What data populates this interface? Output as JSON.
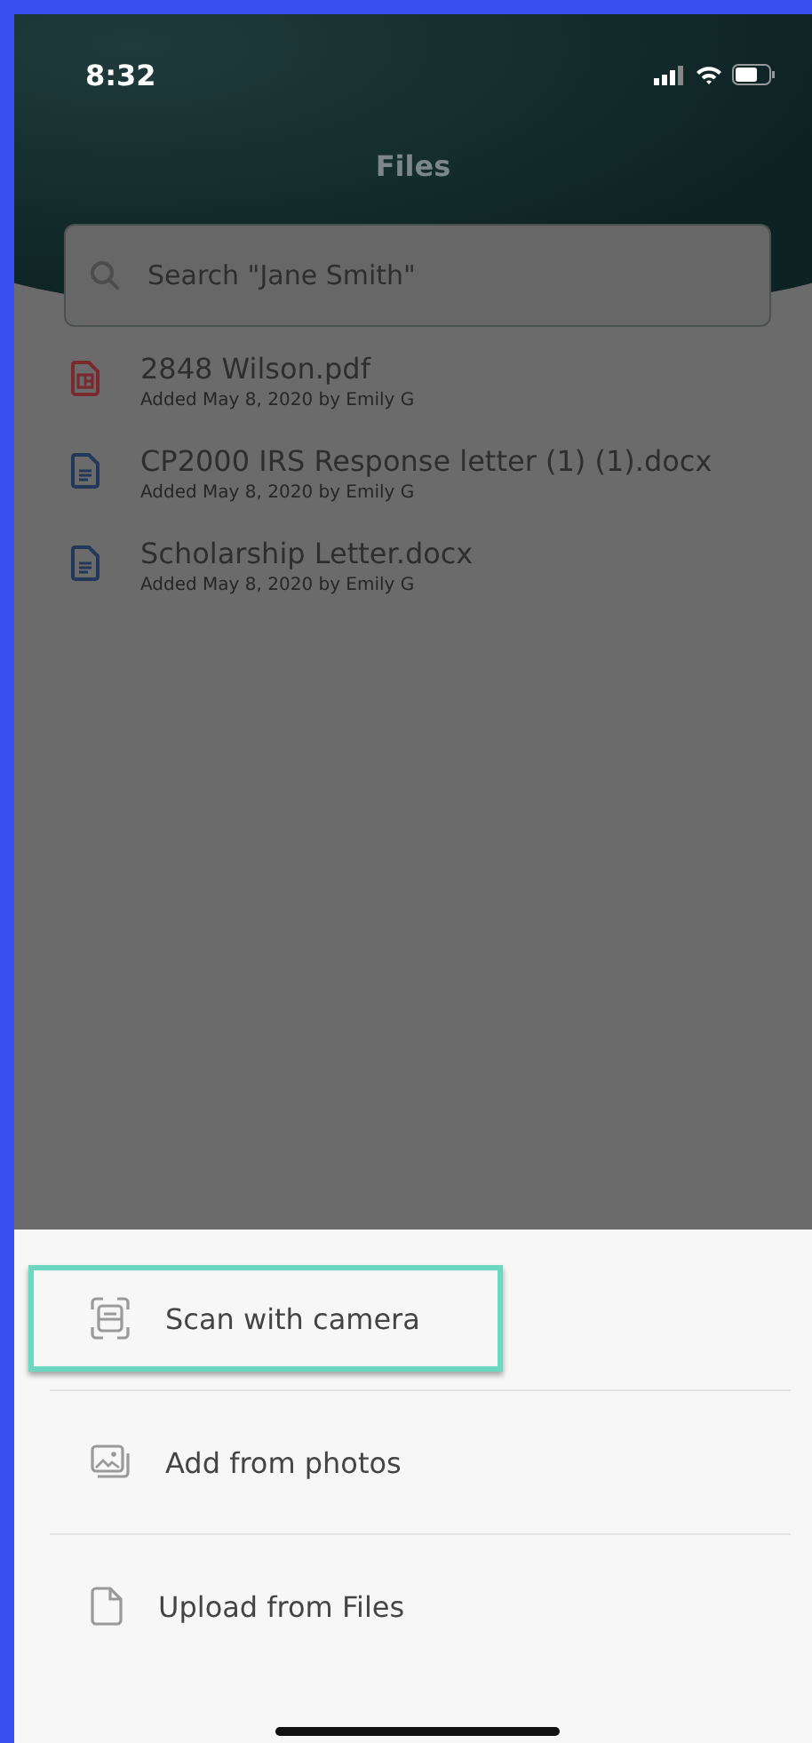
{
  "status_bar": {
    "time": "8:32"
  },
  "header": {
    "title": "Files"
  },
  "search": {
    "placeholder": "Search \"Jane Smith\""
  },
  "files": [
    {
      "name": "2848 Wilson.pdf",
      "meta": "Added May 8, 2020 by Emily G",
      "kind": "pdf"
    },
    {
      "name": "CP2000 IRS Response letter (1) (1).docx",
      "meta": "Added May 8, 2020 by Emily G",
      "kind": "docx"
    },
    {
      "name": "Scholarship Letter.docx",
      "meta": "Added May 8, 2020 by Emily G",
      "kind": "docx"
    }
  ],
  "sheet": {
    "options": [
      {
        "label": "Scan with camera",
        "kind": "scan",
        "highlighted": true
      },
      {
        "label": "Add from photos",
        "kind": "photos",
        "highlighted": false
      },
      {
        "label": "Upload from Files",
        "kind": "file",
        "highlighted": false
      }
    ]
  }
}
